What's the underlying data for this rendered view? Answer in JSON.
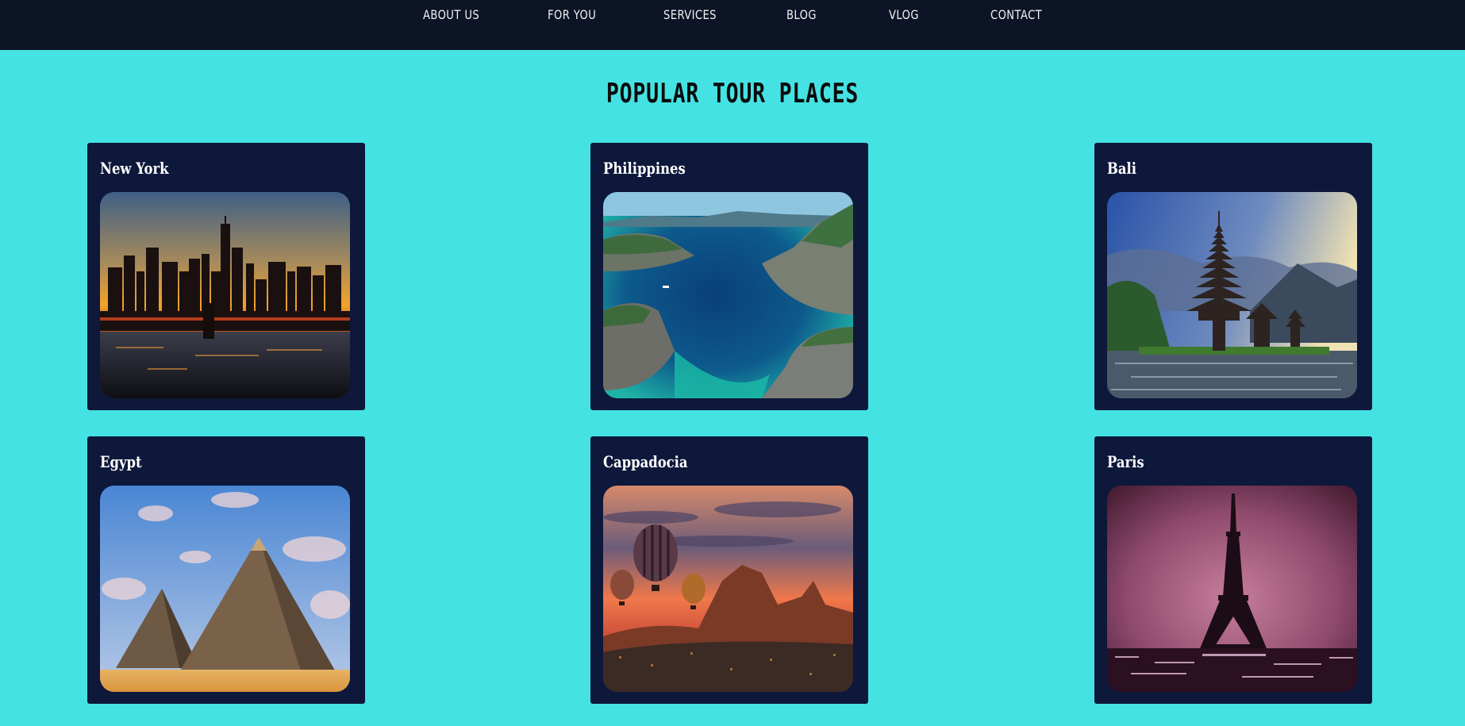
{
  "nav": {
    "items": [
      {
        "label": "ABOUT US"
      },
      {
        "label": "FOR YOU"
      },
      {
        "label": "SERVICES"
      },
      {
        "label": "BLOG"
      },
      {
        "label": "VLOG"
      },
      {
        "label": "CONTACT"
      }
    ]
  },
  "section": {
    "title": "POPULAR TOUR PLACES"
  },
  "places": [
    {
      "name": "New York"
    },
    {
      "name": "Philippines"
    },
    {
      "name": "Bali"
    },
    {
      "name": "Egypt"
    },
    {
      "name": "Cappadocia"
    },
    {
      "name": "Paris"
    }
  ],
  "colors": {
    "page_background": "#45e2e3",
    "nav_background": "#0c1426",
    "card_background": "#0d183b"
  }
}
